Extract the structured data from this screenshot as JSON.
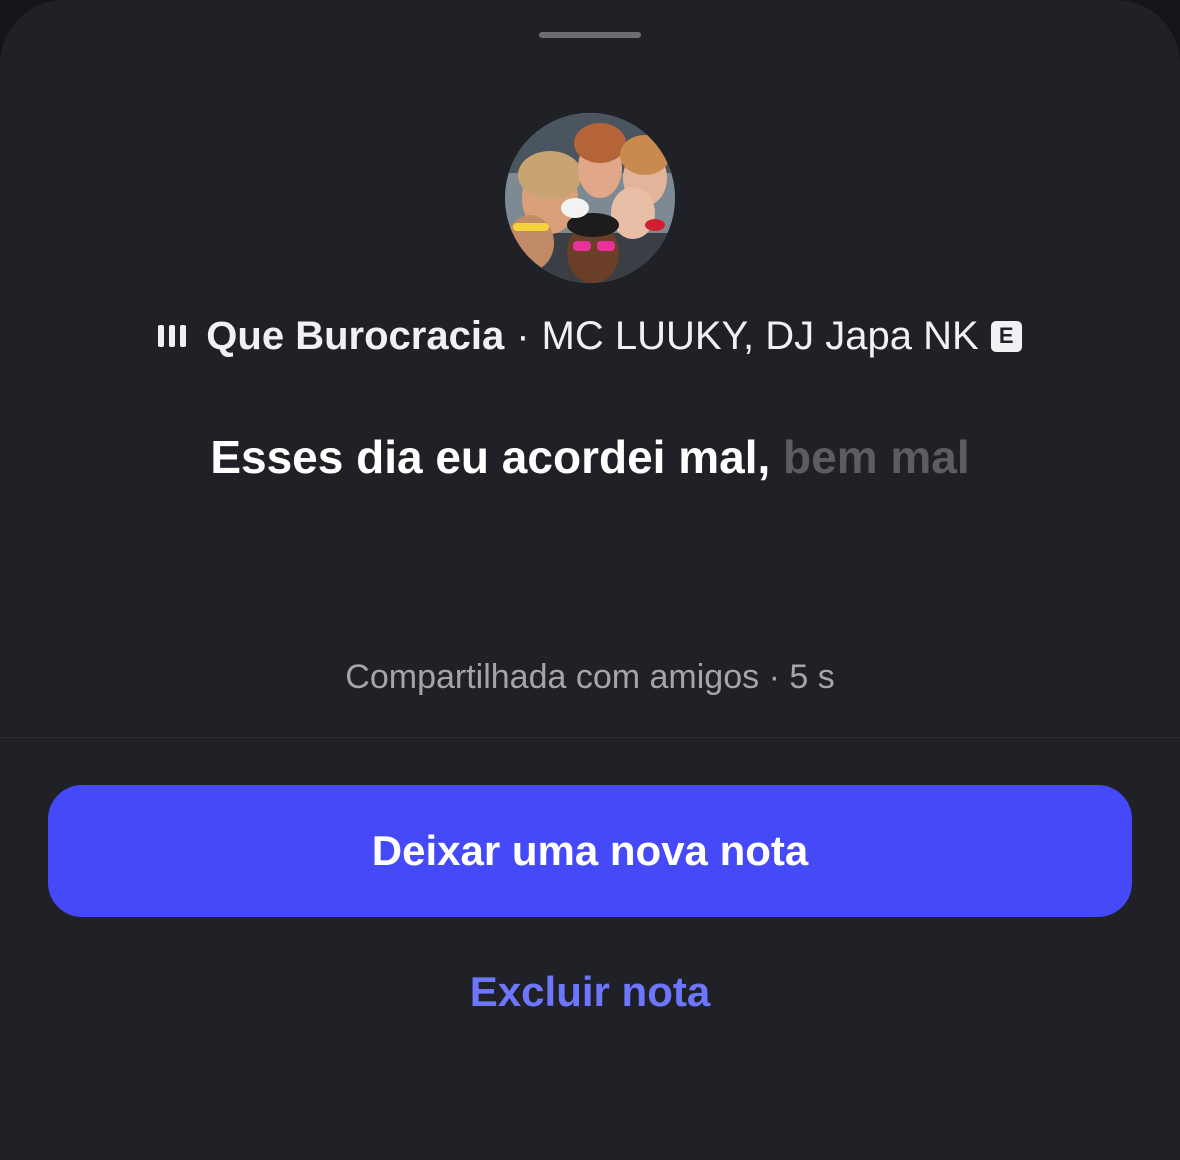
{
  "note": {
    "song_title": "Que Burocracia",
    "separator": "·",
    "artists": "MC LUUKY, DJ Japa NK",
    "explicit_badge": "E",
    "lyric_active": "Esses dia eu acordei mal,",
    "lyric_upcoming": "bem mal",
    "shared_info": "Compartilhada com amigos · 5 s"
  },
  "actions": {
    "new_note_label": "Deixar uma nova nota",
    "delete_note_label": "Excluir nota"
  },
  "colors": {
    "background": "#202126",
    "primary_button": "#4549f7",
    "link": "#6d76ff",
    "muted_text": "#a4a5aa",
    "upcoming_lyric": "#5c5d62"
  },
  "icons": {
    "music": "music-bars-icon",
    "explicit": "explicit-icon"
  }
}
